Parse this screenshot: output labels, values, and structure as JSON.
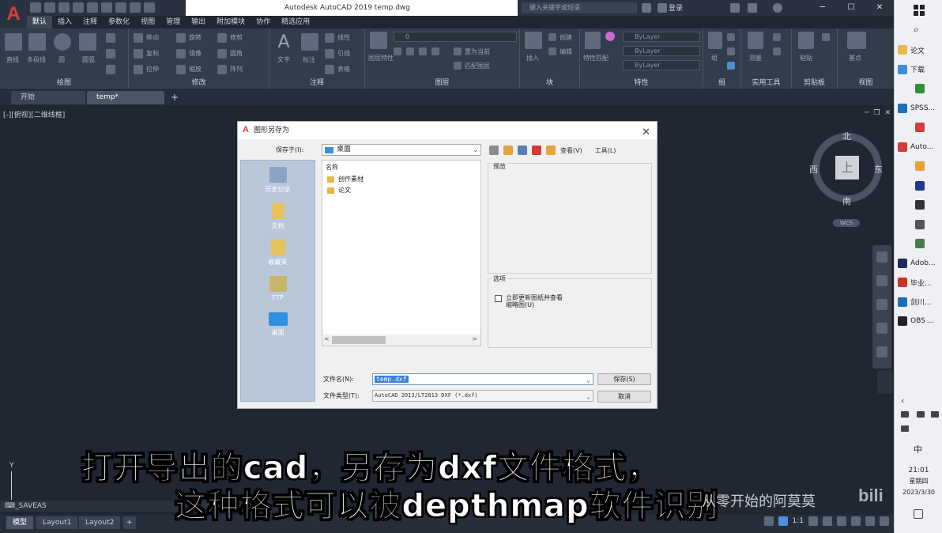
{
  "app": {
    "logo_letter": "A",
    "doc_title": "Autodesk AutoCAD 2019    temp.dwg",
    "search_placeholder": "键入关键字或短语",
    "login_label": "登录",
    "window_buttons": [
      "─",
      "☐",
      "✕"
    ]
  },
  "menu": [
    "默认",
    "插入",
    "注释",
    "参数化",
    "视图",
    "管理",
    "输出",
    "附加模块",
    "协作",
    "精选应用"
  ],
  "ribbon": {
    "panels": [
      "绘图",
      "修改",
      "注释",
      "图层",
      "块",
      "特性",
      "组",
      "实用工具",
      "剪贴板",
      "视图"
    ],
    "texts": {
      "line": "直线",
      "polyline": "多段线",
      "circle": "圆",
      "arc": "圆弧",
      "move": "移动",
      "rotate": "旋转",
      "trim": "修剪",
      "copy": "复制",
      "mirror": "镜像",
      "fillet": "圆角",
      "stretch": "拉伸",
      "scale": "缩放",
      "array": "阵列",
      "text": "文字",
      "dimension": "标注",
      "linear": "线性",
      "leader": "引线",
      "table": "表格",
      "layer_props": "图层特性",
      "layer_value": "0",
      "make_current": "置为当前",
      "match_layer": "匹配图层",
      "insert": "插入",
      "create": "创建",
      "edit": "编辑",
      "match_props": "特性匹配",
      "bylayer": "ByLayer",
      "group": "组",
      "measure": "测量",
      "paste": "粘贴",
      "base": "基点"
    }
  },
  "doc_tabs": {
    "start": "开始",
    "active": "temp*",
    "add": "+"
  },
  "viewport": {
    "label": "[-][俯视][二维线框]",
    "controls": [
      "─",
      "❐",
      "✕"
    ],
    "compass": {
      "north": "北",
      "south": "南",
      "east": "东",
      "west": "西",
      "top": "上"
    },
    "wcs": "WCS",
    "ucs_y": "Y"
  },
  "command_line": "⌨_SAVEAS",
  "layout_tabs": [
    "模型",
    "Layout1",
    "Layout2",
    "+"
  ],
  "status_bar": {
    "scale": "1:1"
  },
  "dialog": {
    "title": "图形另存为",
    "close": "✕",
    "save_in_label": "保存于(I):",
    "save_in_value": "桌面",
    "toolbar": {
      "views": "查看(V)",
      "tools": "工具(L)"
    },
    "places": [
      "历史记录",
      "文档",
      "收藏夹",
      "FTP",
      "桌面"
    ],
    "col_name": "名称",
    "files": [
      "创作素材",
      "论文"
    ],
    "preview_label": "预览",
    "options_label": "选项",
    "option_line1": "立即更新图纸并查看",
    "option_line2": "缩略图(U)",
    "filename_label": "文件名(N):",
    "filename_value": "temp.dxf",
    "filetype_label": "文件类型(T):",
    "filetype_value": "AutoCAD 2013/LT2013 DXF (*.dxf)",
    "save_button": "保存(S)",
    "cancel_button": "取消"
  },
  "subtitle": {
    "line1": "打开导出的cad，另存为dxf文件格式，",
    "line2": "这种格式可以被depthmap软件识别",
    "watermark": "从零开始的阿莫莫",
    "bili": "bili"
  },
  "taskbar": {
    "items": [
      "论文",
      "下载",
      "",
      "SPSS...",
      "",
      "Auto...",
      "",
      "",
      "",
      "",
      "",
      "Adob...",
      "毕业...",
      "剑川...",
      "OBS ..."
    ],
    "item_colors": [
      "#e8b84a",
      "#3b8fd8",
      "#2f8f3b",
      "#1f6fb8",
      "#d83b3b",
      "#d83b3b",
      "#e7a13a",
      "#1e3a8a",
      "#333333",
      "#555555",
      "#4a7a4a",
      "#1e2a5a",
      "#c8322a",
      "#1b6fb5",
      "#222222"
    ],
    "ime": "中",
    "time": "21:01",
    "weekday": "星期四",
    "date": "2023/3/30"
  }
}
